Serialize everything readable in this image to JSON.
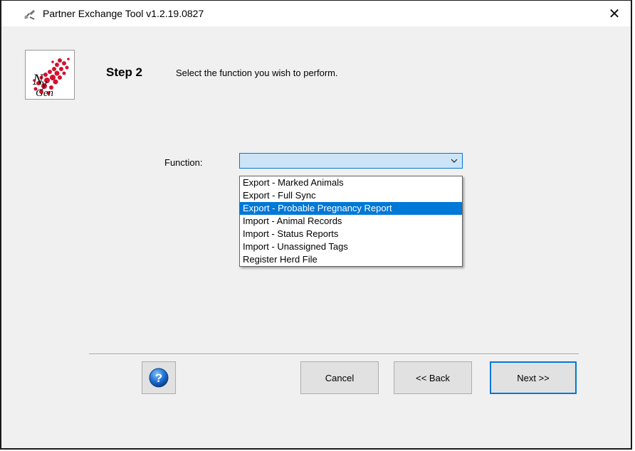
{
  "window": {
    "title": "Partner Exchange Tool v1.2.19.0827",
    "close_glyph": "✕"
  },
  "header": {
    "step_title": "Step 2",
    "step_description": "Select the function you wish to perform.",
    "logo_text": "NY Gen"
  },
  "form": {
    "function_label": "Function:",
    "function_value": "",
    "options": [
      "Export - Marked Animals",
      "Export - Full Sync",
      "Export - Probable Pregnancy Report",
      "Import - Animal Records",
      "Import - Status Reports",
      "Import - Unassigned Tags",
      "Register Herd File"
    ],
    "highlighted_option": "Export - Probable Pregnancy Report"
  },
  "footer": {
    "help_glyph": "?",
    "cancel_label": "Cancel",
    "back_label": "<< Back",
    "next_label": "Next >>"
  },
  "colors": {
    "accent": "#0078d7",
    "logo_red": "#d2112e"
  }
}
